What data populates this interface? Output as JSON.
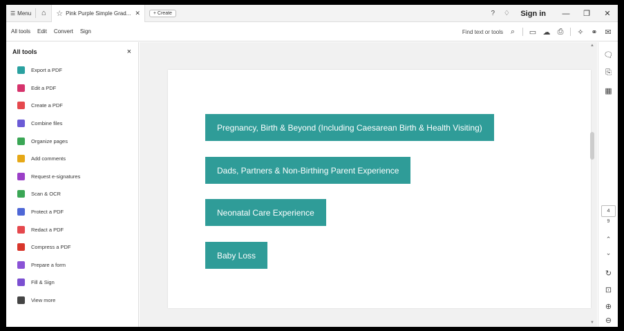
{
  "titlebar": {
    "menu_label": "Menu",
    "tab_title": "Pink Purple Simple Grad...",
    "create_label": "Create",
    "sign_in": "Sign in"
  },
  "toolbar": {
    "menus": [
      "All tools",
      "Edit",
      "Convert",
      "Sign"
    ],
    "find_label": "Find text or tools"
  },
  "panel": {
    "title": "All tools",
    "items": [
      {
        "label": "Export a PDF",
        "color": "#2aa1a0"
      },
      {
        "label": "Edit a PDF",
        "color": "#d6336c"
      },
      {
        "label": "Create a PDF",
        "color": "#e5484d"
      },
      {
        "label": "Combine files",
        "color": "#6b5bd6"
      },
      {
        "label": "Organize pages",
        "color": "#3aa655"
      },
      {
        "label": "Add comments",
        "color": "#e6a817"
      },
      {
        "label": "Request e-signatures",
        "color": "#9b3fc7"
      },
      {
        "label": "Scan & OCR",
        "color": "#3aa655"
      },
      {
        "label": "Protect a PDF",
        "color": "#4e67d6"
      },
      {
        "label": "Redact a PDF",
        "color": "#e5484d"
      },
      {
        "label": "Compress a PDF",
        "color": "#d8362b"
      },
      {
        "label": "Prepare a form",
        "color": "#8a53d6"
      },
      {
        "label": "Fill & Sign",
        "color": "#7b4fd1"
      },
      {
        "label": "View more",
        "color": "#444444"
      }
    ]
  },
  "document": {
    "buttons": [
      "Pregnancy, Birth & Beyond (Including Caesarean Birth & Health Visiting)",
      "Dads, Partners & Non-Birthing Parent Experience",
      "Neonatal Care Experience",
      "Baby Loss"
    ],
    "accent": "#2f9c98"
  },
  "rail": {
    "current_page": "4",
    "total_pages": "9"
  }
}
